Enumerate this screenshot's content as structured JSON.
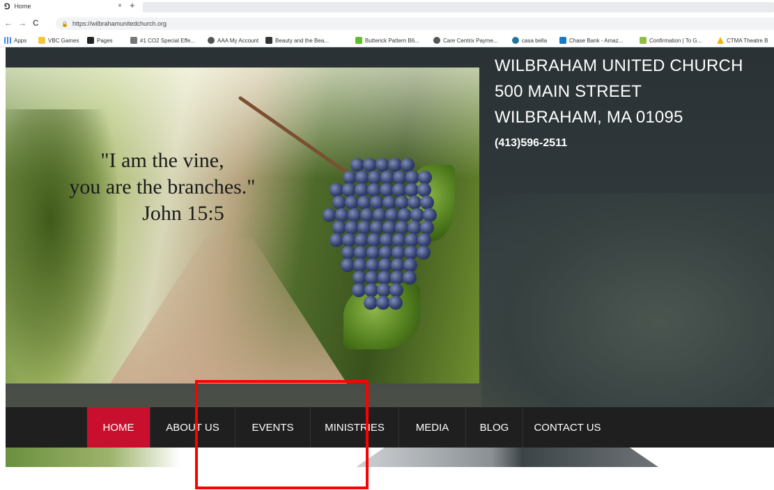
{
  "browser": {
    "tab": {
      "title": "Home",
      "close_glyph": "×",
      "favicon": "bluetooth-like-logo-icon"
    },
    "new_tab_glyph": "+",
    "nav": {
      "back": "←",
      "forward": "→",
      "reload": "C"
    },
    "url": "https://wilbrahamunitedchurch.org",
    "bookmarks": [
      {
        "label": "Apps",
        "icon": "apps-grid-icon",
        "color": "#4285f4"
      },
      {
        "label": "VBC Games",
        "icon": "folder-icon",
        "color": "#f4c542"
      },
      {
        "label": "Pages",
        "icon": "pages-icon",
        "color": "#222222"
      },
      {
        "label": "#1 CO2 Special Effe...",
        "icon": "effects-icon",
        "color": "#555555"
      },
      {
        "label": "AAA My Account",
        "icon": "globe-icon",
        "color": "#444444"
      },
      {
        "label": "Beauty and the Bea...",
        "icon": "site-icon",
        "color": "#333333"
      },
      {
        "label": "Butterick Pattern B6...",
        "icon": "butterick-icon",
        "color": "#5cbf2a"
      },
      {
        "label": "Care Centrix Payme...",
        "icon": "globe-icon",
        "color": "#444444"
      },
      {
        "label": "casa bella",
        "icon": "wordpress-icon",
        "color": "#21759b"
      },
      {
        "label": "Chase Bank - Amaz...",
        "icon": "chase-icon",
        "color": "#117aca"
      },
      {
        "label": "Confirmation | To G...",
        "icon": "confirmation-icon",
        "color": "#8fbf3f"
      },
      {
        "label": "CTMA Theatre B",
        "icon": "drive-icon",
        "color": "#f4b400"
      }
    ]
  },
  "church": {
    "name": "WILBRAHAM UNITED CHURCH",
    "street": "500 MAIN STREET",
    "city": "WILBRAHAM, MA 01095",
    "phone": "(413)596-2511"
  },
  "banner": {
    "quote_line1": "\"I am the vine,",
    "quote_line2": "you are the branches.\"",
    "quote_ref": "John 15:5"
  },
  "nav_menu": {
    "active_color": "#c8102e",
    "items": [
      {
        "label": "HOME",
        "active": true
      },
      {
        "label": "ABOUT US",
        "active": false
      },
      {
        "label": "EVENTS",
        "active": false
      },
      {
        "label": "MINISTRIES",
        "active": false
      },
      {
        "label": "MEDIA",
        "active": false
      },
      {
        "label": "BLOG",
        "active": false
      },
      {
        "label": "CONTACT US",
        "active": false
      }
    ]
  },
  "annotation": {
    "highlight_color": "#ff0000"
  }
}
